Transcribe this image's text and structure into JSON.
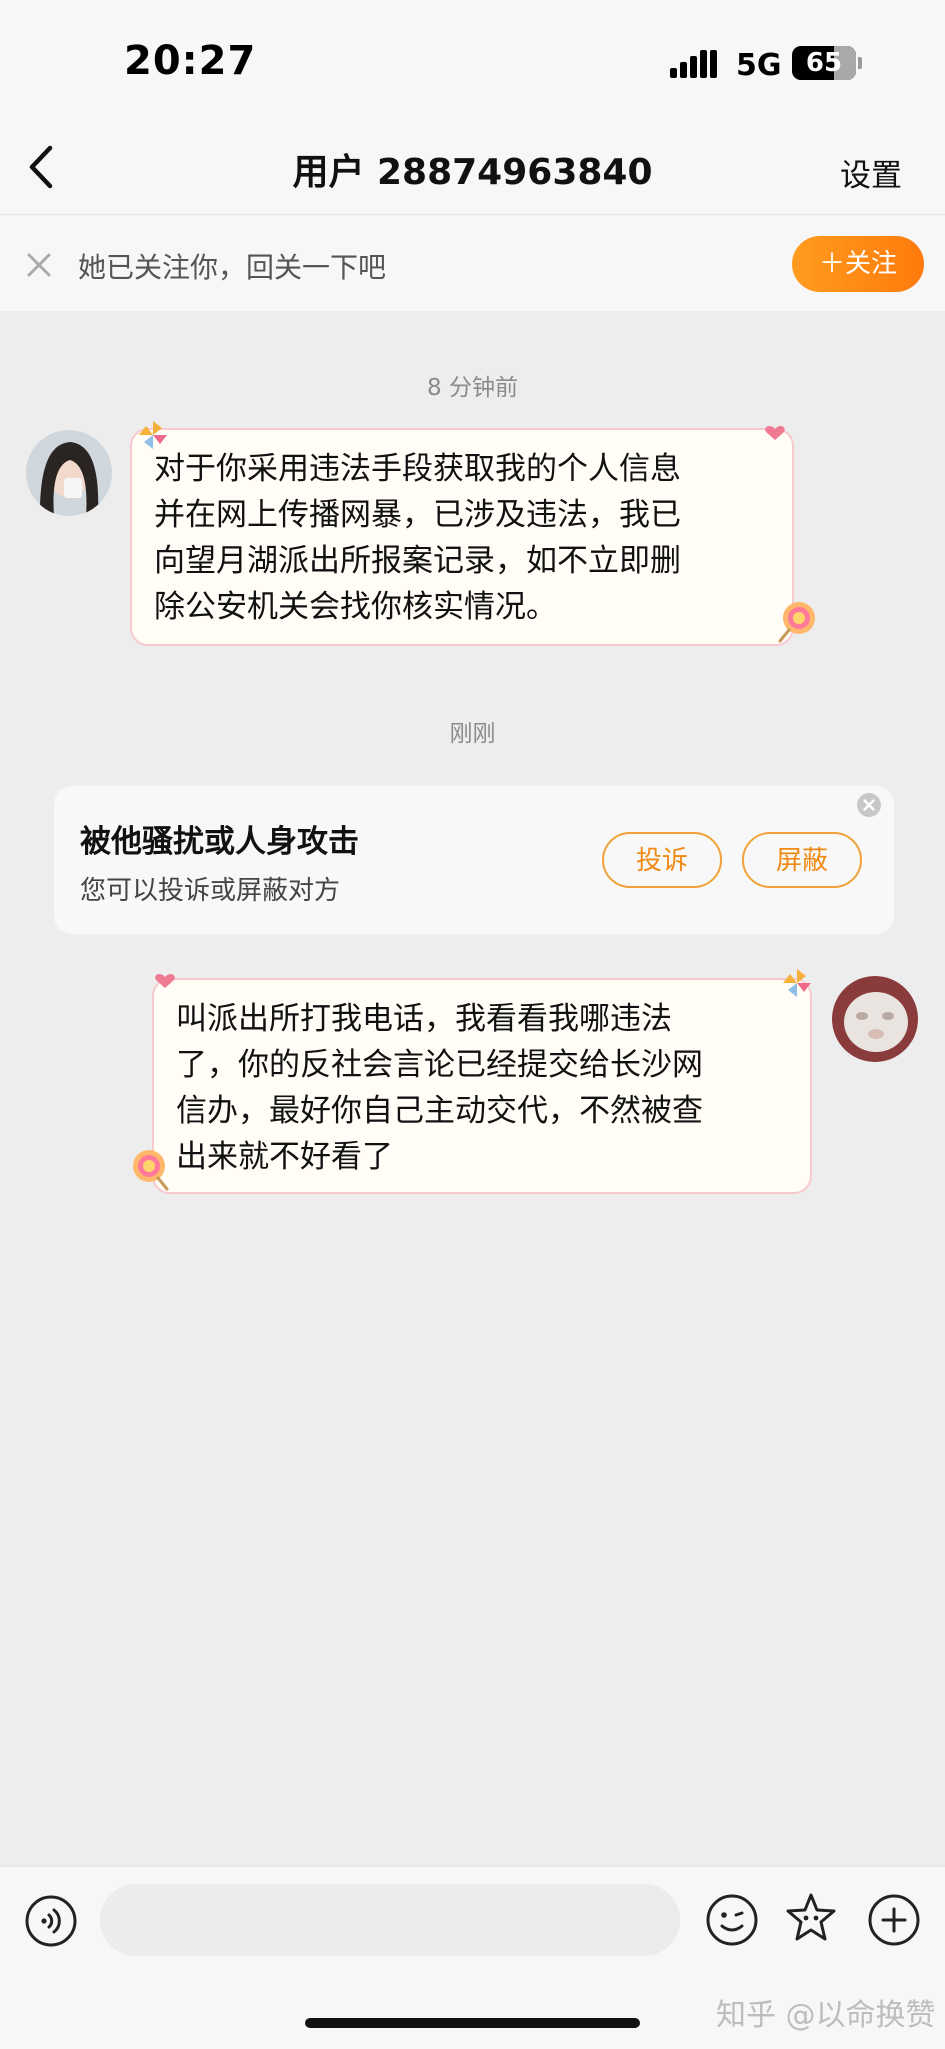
{
  "status_bar": {
    "time": "20:27",
    "network": "5G",
    "battery": "65",
    "battery_level": 0.65
  },
  "nav": {
    "title": "用户 28874963840",
    "settings_label": "设置",
    "back_icon": "chevron-left-icon"
  },
  "follow_banner": {
    "text": "她已关注你，回关一下吧",
    "button_label": "＋关注",
    "close_icon": "close-icon"
  },
  "chat": {
    "timestamp_1": "8 分钟前",
    "message_1": {
      "lines": [
        "对于你采用违法手段获取我的个人信息",
        "并在网上传播网暴，已涉及违法，我已",
        "向望月湖派出所报案记录，如不立即删",
        "除公安机关会找你核实情况。"
      ]
    },
    "timestamp_2": "刚刚",
    "harassment_card": {
      "title": "被他骚扰或人身攻击",
      "subtitle": "您可以投诉或屏蔽对方",
      "complain_label": "投诉",
      "block_label": "屏蔽"
    },
    "message_2": {
      "lines": [
        "叫派出所打我电话，我看看我哪违法",
        "了，你的反社会言论已经提交给长沙网",
        "信办，最好你自己主动交代，不然被查",
        "出来就不好看了"
      ]
    }
  },
  "input_bar": {
    "placeholder": "",
    "icons": [
      "voice-icon",
      "emoji-icon",
      "sticker-icon",
      "plus-icon"
    ]
  },
  "watermark": "知乎 @以命换赞",
  "colors": {
    "accent_orange": "#ff8a14",
    "bubble_border": "#f7c9cf",
    "background": "#ededed"
  }
}
